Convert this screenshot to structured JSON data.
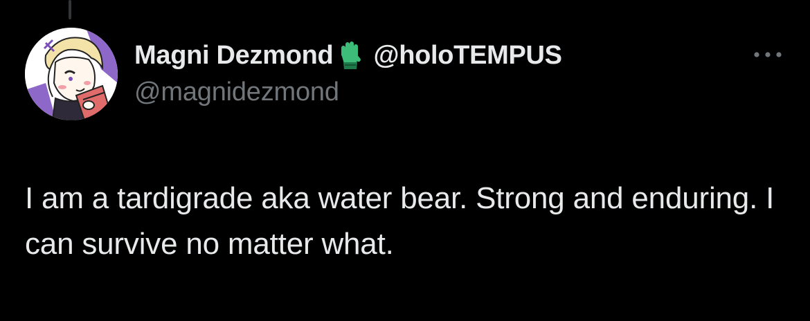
{
  "tweet": {
    "author": {
      "display_name": "Magni Dezmond",
      "affiliate_badge_icon": "green-glove-icon",
      "affiliate_handle": "@holoTEMPUS",
      "handle": "@magnidezmond",
      "avatar_icon": "anime-character-avatar"
    },
    "more_icon": "more-options-icon",
    "text": "I am a tardigrade aka water bear. Strong and enduring. I can survive no matter what."
  },
  "colors": {
    "background": "#000000",
    "primary_text": "#e7e9ea",
    "secondary_text": "#71767b",
    "badge_green": "#3dbb78"
  }
}
